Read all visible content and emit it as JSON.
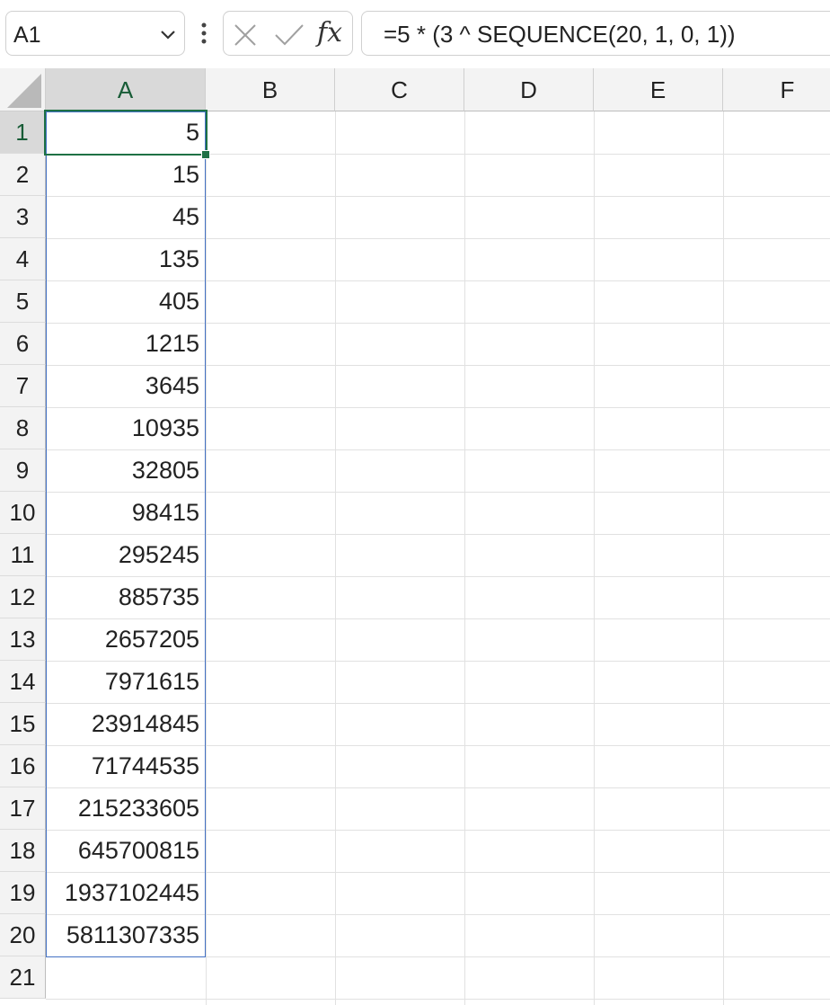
{
  "name_box": {
    "value": "A1"
  },
  "formula_bar": {
    "formula": "=5 * (3 ^ SEQUENCE(20, 1, 0, 1))",
    "fx_label": "fx"
  },
  "columns": [
    "A",
    "B",
    "C",
    "D",
    "E",
    "F"
  ],
  "rows": [
    "1",
    "2",
    "3",
    "4",
    "5",
    "6",
    "7",
    "8",
    "9",
    "10",
    "11",
    "12",
    "13",
    "14",
    "15",
    "16",
    "17",
    "18",
    "19",
    "20",
    "21"
  ],
  "cells_a": [
    "5",
    "15",
    "45",
    "135",
    "405",
    "1215",
    "3645",
    "10935",
    "32805",
    "98415",
    "295245",
    "885735",
    "2657205",
    "7971615",
    "23914845",
    "71744535",
    "215233605",
    "645700815",
    "1937102445",
    "5811307335",
    ""
  ],
  "colors": {
    "accent": "#1e7145",
    "spill_border": "#4472c4",
    "header_bg": "#f3f3f3",
    "header_selected_bg": "#d9d9d9"
  }
}
